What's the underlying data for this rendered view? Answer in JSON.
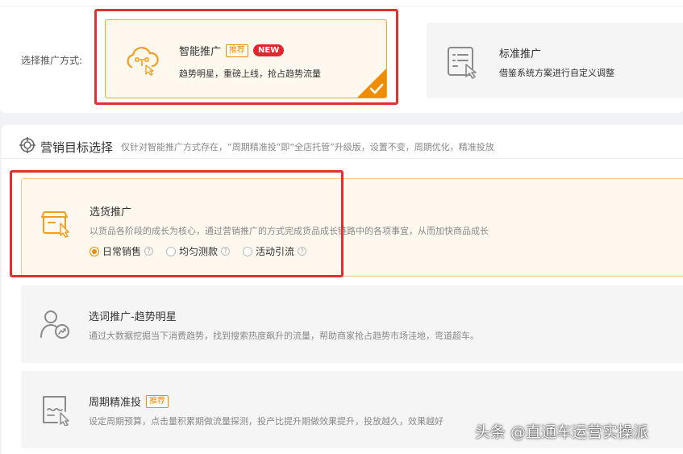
{
  "method": {
    "label": "选择推广方式:",
    "smart": {
      "title": "智能推广",
      "tag": "推荐",
      "badge": "NEW",
      "desc": "趋势明星，重磅上线，抢占趋势流量"
    },
    "standard": {
      "title": "标准推广",
      "desc": "借鉴系统方案进行自定义调整"
    }
  },
  "goal": {
    "title": "营销目标选择",
    "subtitle": "仅针对智能推广方式存在，“周期精准投”即“全店托管”升级版，设置不变，周期优化，精准投放",
    "goods": {
      "title": "选货推广",
      "desc": "以货品各阶段的成长为核心，通过营销推广的方式完成货品成长链路中的各项事宜，从而加快商品成长",
      "options": [
        "日常销售",
        "均匀测款",
        "活动引流"
      ],
      "selected": "日常销售"
    },
    "keyword": {
      "title": "选词推广-趋势明星",
      "desc": "通过大数据挖掘当下消费趋势，找到搜索热度飙升的流量，帮助商家抢占趋势市场洼地，弯道超车。"
    },
    "period": {
      "title": "周期精准投",
      "tag": "推荐",
      "desc": "设定周期预算，点击量积累期做流量探测，投产比提升期做效果提升，投放越久，效果越好"
    }
  },
  "watermark": "头条 @直通车运营实操派",
  "colors": {
    "accent": "#f08c00",
    "selected_bg": "#fff8ee",
    "highlight_box": "#e03030",
    "new_badge": "#e4262e"
  }
}
